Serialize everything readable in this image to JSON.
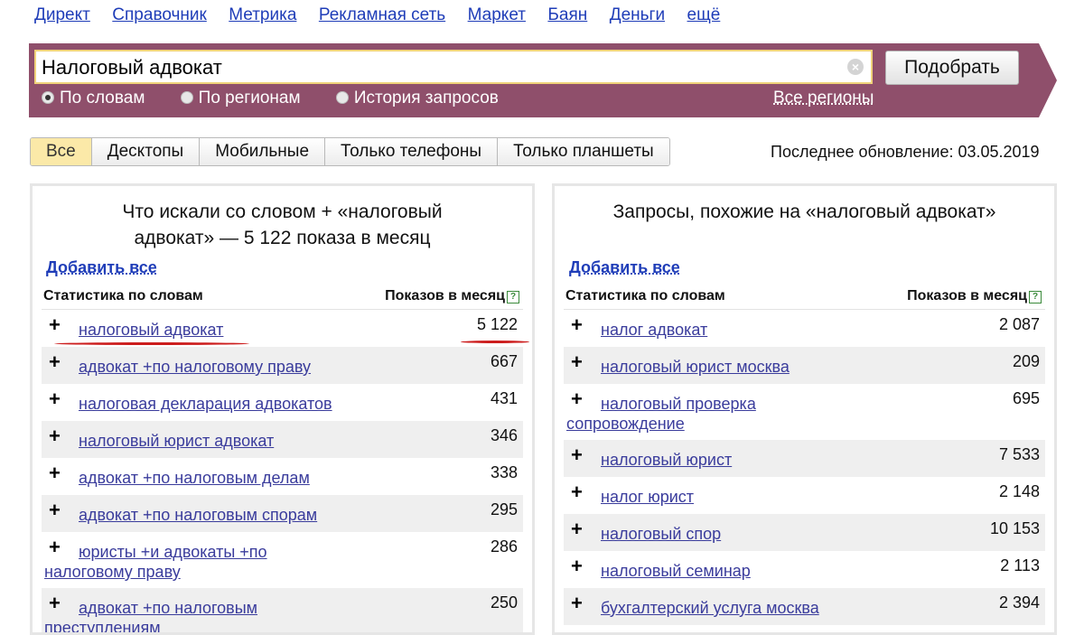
{
  "topnav": [
    "Директ",
    "Справочник",
    "Метрика",
    "Рекламная сеть",
    "Маркет",
    "Баян",
    "Деньги",
    "ещё"
  ],
  "search": {
    "value": "Налоговый адвокат",
    "submit_label": "Подобрать"
  },
  "modes": [
    {
      "label": "По словам",
      "selected": true
    },
    {
      "label": "По регионам",
      "selected": false
    },
    {
      "label": "История запросов",
      "selected": false
    }
  ],
  "regions_link": "Все регионы",
  "device_tabs": [
    {
      "label": "Все",
      "active": true
    },
    {
      "label": "Десктопы",
      "active": false
    },
    {
      "label": "Мобильные",
      "active": false
    },
    {
      "label": "Только телефоны",
      "active": false
    },
    {
      "label": "Только планшеты",
      "active": false
    }
  ],
  "last_update": "Последнее обновление: 03.05.2019",
  "left_panel": {
    "title": "Что искали со словом + «налоговый адвокат» — 5 122 показа в месяц",
    "add_all": "Добавить все",
    "col_phrase": "Статистика по словам",
    "col_count": "Показов в месяц",
    "rows": [
      {
        "phrase": "налоговый адвокат",
        "count": "5 122"
      },
      {
        "phrase": "адвокат +по налоговому праву",
        "count": "667"
      },
      {
        "phrase": "налоговая декларация адвокатов",
        "count": "431"
      },
      {
        "phrase": "налоговый юрист адвокат",
        "count": "346"
      },
      {
        "phrase": "адвокат +по налоговым делам",
        "count": "338"
      },
      {
        "phrase": "адвокат +по налоговым спорам",
        "count": "295"
      },
      {
        "phrase": "юристы +и адвокаты +по налоговому праву",
        "count": "286"
      },
      {
        "phrase": "адвокат +по налоговым преступлениям",
        "count": "250"
      }
    ]
  },
  "right_panel": {
    "title": "Запросы, похожие на «налоговый адвокат»",
    "add_all": "Добавить все",
    "col_phrase": "Статистика по словам",
    "col_count": "Показов в месяц",
    "rows": [
      {
        "phrase": "налог адвокат",
        "count": "2 087"
      },
      {
        "phrase": "налоговый юрист москва",
        "count": "209"
      },
      {
        "phrase": "налоговый проверка сопровождение",
        "count": "695"
      },
      {
        "phrase": "налоговый юрист",
        "count": "7 533"
      },
      {
        "phrase": "налог юрист",
        "count": "2 148"
      },
      {
        "phrase": "налоговый спор",
        "count": "10 153"
      },
      {
        "phrase": "налоговый семинар",
        "count": "2 113"
      },
      {
        "phrase": "бухгалтерский услуга москва",
        "count": "2 394"
      }
    ]
  },
  "colors": {
    "band": "#8f4f6b",
    "link": "#1f3db8",
    "phrase": "#3a3c9c",
    "tab_active": "#fbe9a8",
    "highlight": "#cc1d1d"
  }
}
